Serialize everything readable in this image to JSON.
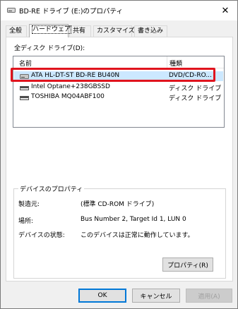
{
  "window": {
    "title": "BD-RE ドライブ (E:)のプロパティ"
  },
  "tabs": [
    {
      "label": "全般",
      "active": false
    },
    {
      "label": "ハードウェア",
      "active": true
    },
    {
      "label": "共有",
      "active": false
    },
    {
      "label": "カスタマイズ",
      "active": false
    },
    {
      "label": "書き込み",
      "active": false
    }
  ],
  "hardware": {
    "all_drives_label": "全ディスク ドライブ(D):",
    "columns": {
      "name": "名前",
      "type": "種類"
    },
    "drives": [
      {
        "name": "ATA HL-DT-ST BD-RE BU40N",
        "type": "DVD/CD-RO...",
        "icon": "optical-drive-icon",
        "selected": true
      },
      {
        "name": "Intel Optane+238GBSSD",
        "type": "ディスク ドライブ",
        "icon": "disk-drive-icon",
        "selected": false
      },
      {
        "name": "TOSHIBA MQ04ABF100",
        "type": "ディスク ドライブ",
        "icon": "disk-drive-icon",
        "selected": false
      }
    ]
  },
  "device_properties": {
    "title": "デバイスのプロパティ",
    "rows": [
      {
        "label": "製造元:",
        "value": "(標準 CD-ROM ドライブ)"
      },
      {
        "label": "場所:",
        "value": "Bus Number 2, Target Id 1, LUN 0"
      },
      {
        "label": "デバイスの状態:",
        "value": "このデバイスは正常に動作しています。"
      }
    ],
    "properties_button": "プロパティ(R)"
  },
  "footer": {
    "ok": "OK",
    "cancel": "キャンセル",
    "apply": "適用(A)"
  },
  "colors": {
    "selection": "#cce8ff",
    "highlight_box": "#e0141e",
    "accent": "#0078d7"
  }
}
